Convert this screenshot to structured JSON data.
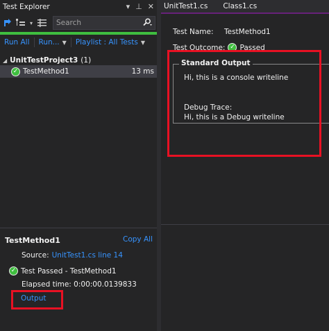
{
  "test_explorer": {
    "title": "Test Explorer",
    "window_buttons": [
      "▾",
      "📌",
      "✕"
    ],
    "search_placeholder": "Search",
    "run_all": "Run All",
    "run": "Run...",
    "playlist": "Playlist : All Tests",
    "group": {
      "name": "UnitTestProject3",
      "count": "(1)"
    },
    "item": {
      "name": "TestMethod1",
      "duration": "13 ms"
    },
    "detail": {
      "title": "TestMethod1",
      "copy_all": "Copy All",
      "source_label": "Source:",
      "source_link": "UnitTest1.cs line 14",
      "passed": "Test Passed - TestMethod1",
      "elapsed": "Elapsed time: 0:00:00.0139833",
      "output_link": "Output"
    }
  },
  "tabs": [
    "UnitTest1.cs",
    "Class1.cs"
  ],
  "result": {
    "name_label": "Test Name:",
    "name_value": "TestMethod1",
    "outcome_label": "Test Outcome:",
    "outcome_value": "Passed",
    "stdout_title": "Standard Output",
    "stdout_line1": "Hi, this is a console writeline",
    "stdout_line2": "Debug Trace:",
    "stdout_line3": "Hi, this is a Debug writeline"
  },
  "colors": {
    "highlight": "#e81123",
    "pass": "#3fbe3f",
    "link": "#3794ff",
    "tab_accent": "#68217a"
  }
}
